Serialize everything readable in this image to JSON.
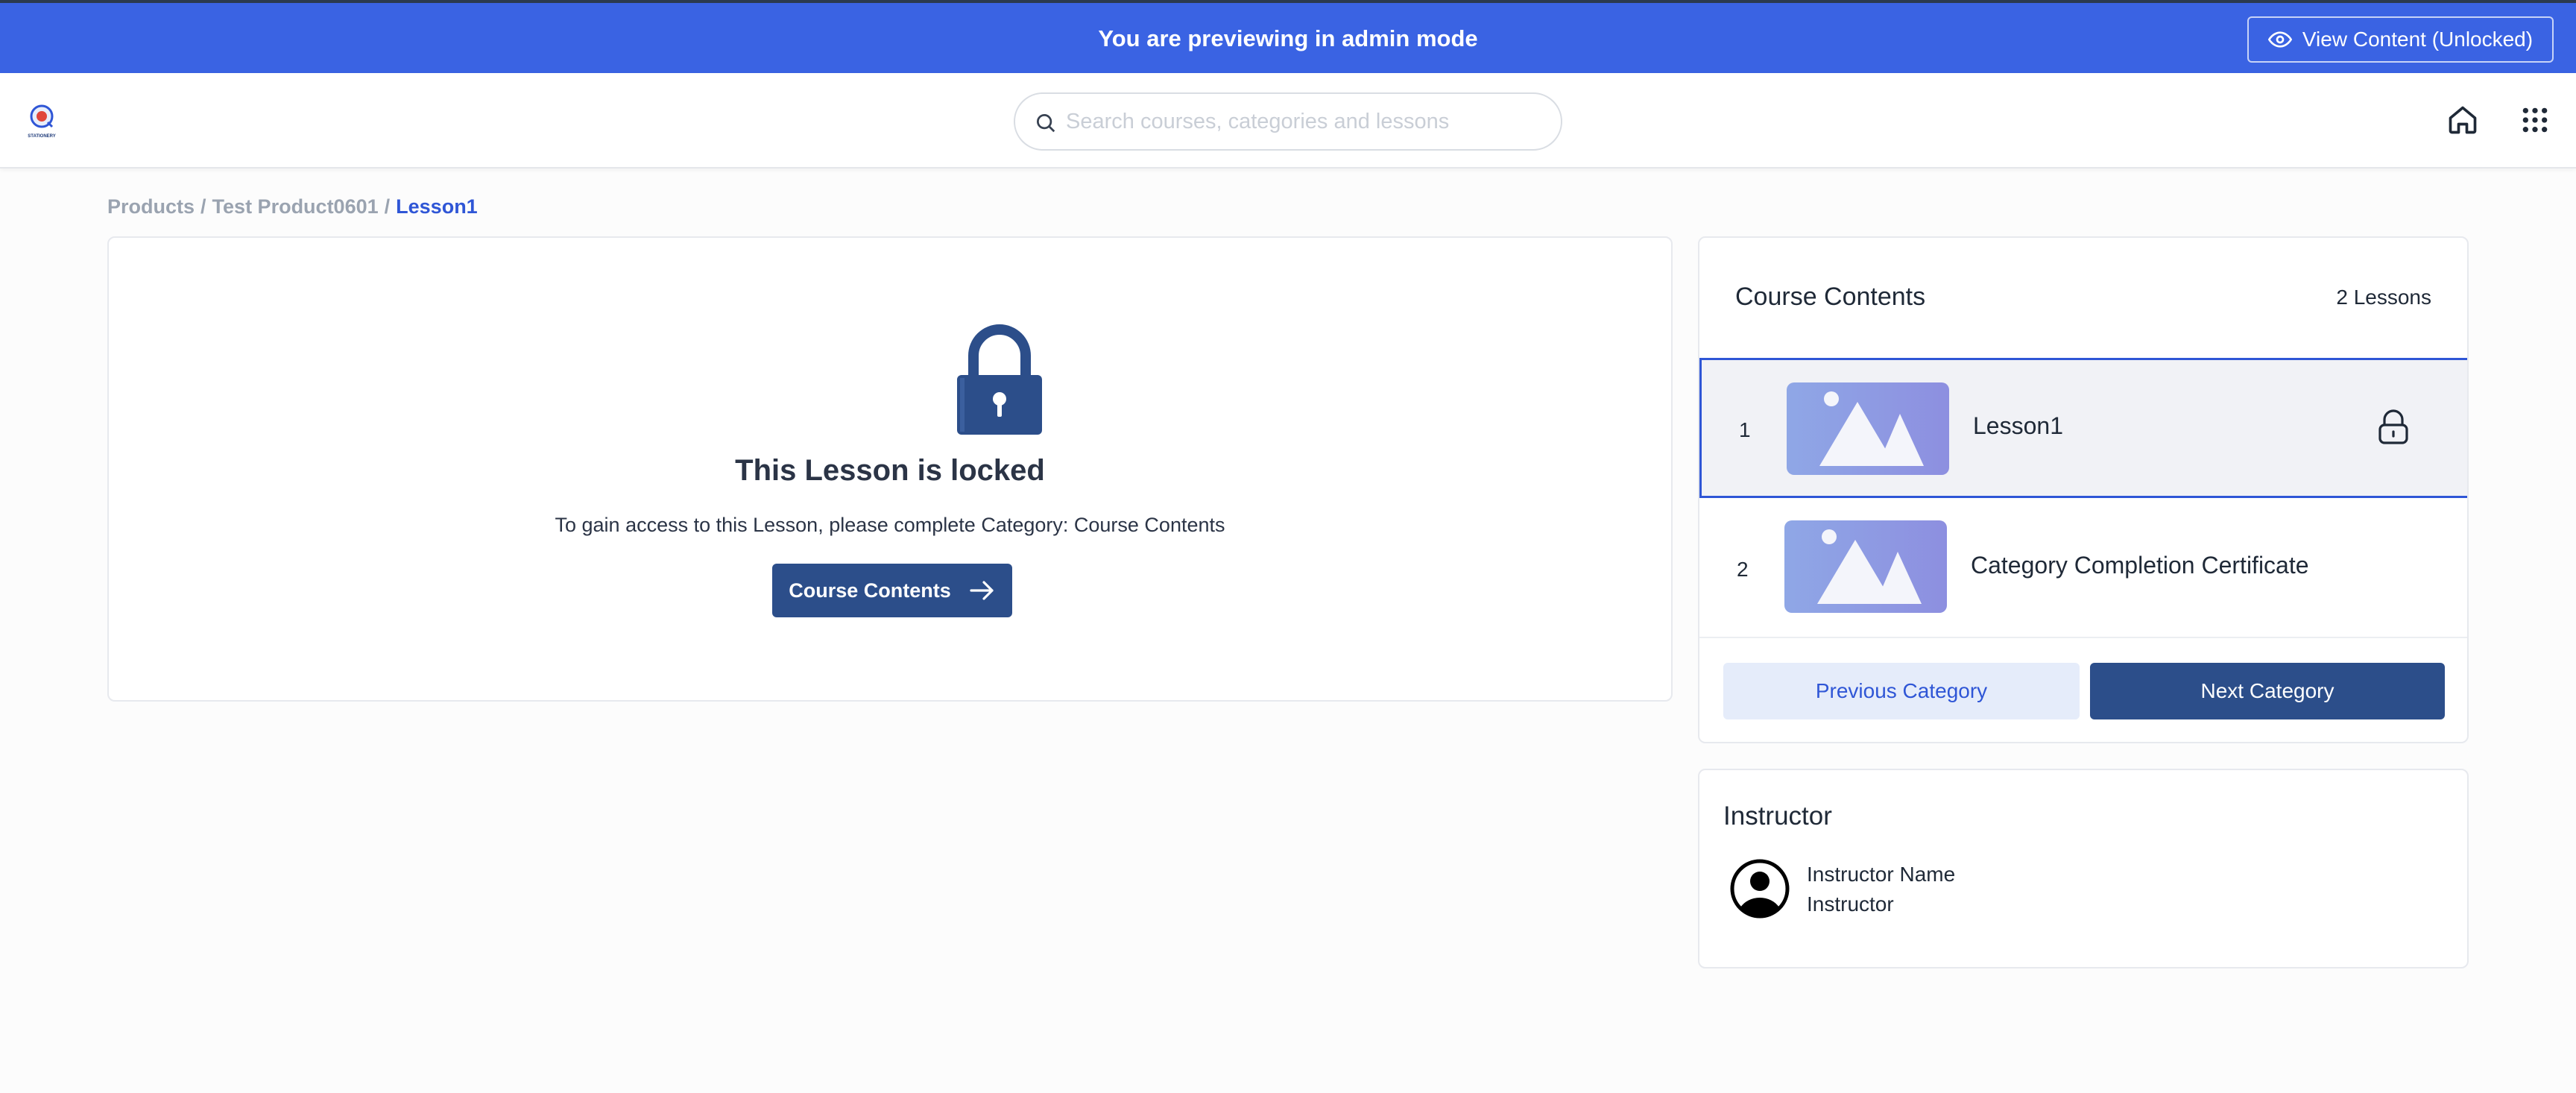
{
  "admin_bar": {
    "message": "You are previewing in admin mode",
    "view_button_label": "View Content (Unlocked)",
    "view_button_icon": "eye-icon"
  },
  "header": {
    "logo_text": "STATIONERY",
    "search_placeholder": "Search courses, categories and lessons",
    "search_value": "",
    "icons": [
      "search-icon",
      "home-icon",
      "apps-grid-icon"
    ]
  },
  "breadcrumb": {
    "items": [
      "Products",
      "Test Product0601",
      "Lesson1"
    ],
    "separator": "/"
  },
  "locked": {
    "icon": "padlock-icon",
    "title": "This Lesson is locked",
    "description": "To gain access to this Lesson, please complete Category: Course Contents",
    "button_label": "Course Contents",
    "button_icon": "arrow-right-icon"
  },
  "contents": {
    "title": "Course Contents",
    "count": "2 Lessons",
    "lessons": [
      {
        "number": "1",
        "label": "Lesson1",
        "thumbnail": "image-placeholder-icon",
        "status_icon": "lock-icon",
        "active": true
      },
      {
        "number": "2",
        "label": "Category Completion Certificate",
        "thumbnail": "image-placeholder-icon",
        "active": false
      }
    ],
    "prev_label": "Previous Category",
    "next_label": "Next Category"
  },
  "instructor": {
    "title": "Instructor",
    "name": "Instructor Name",
    "role": "Instructor",
    "avatar_icon": "user-avatar-icon"
  },
  "colors": {
    "admin_bar": "#3a63e3",
    "primary_dark": "#2c4e8a",
    "accent_blue": "#2f56d6",
    "secondary_button_bg": "#e5ecfa",
    "active_row_bg": "#f1f2f6"
  }
}
